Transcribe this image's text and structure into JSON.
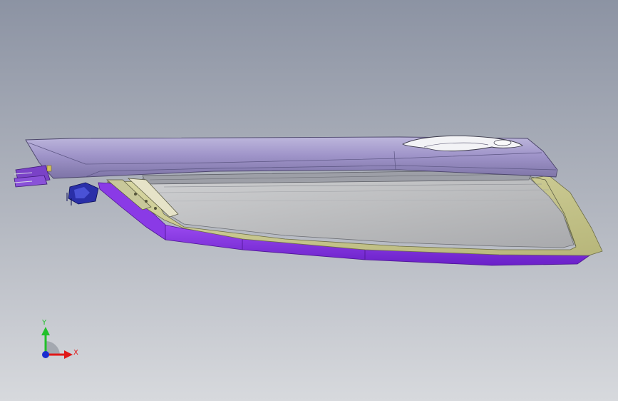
{
  "viewport": {
    "background_top": "#8c93a3",
    "background_bottom": "#d7d9dd"
  },
  "triad": {
    "y_label": "Y",
    "x_label": "X",
    "y_color": "#22c02a",
    "x_color": "#e01818",
    "z_color": "#1a2ccf"
  },
  "colors": {
    "door_top": "#9a8fc4",
    "door_trim": "#7f2fe0",
    "glass": "#b9bbbe",
    "frame_olive": "#c9c890",
    "bracket_blue": "#2a2fa8"
  }
}
